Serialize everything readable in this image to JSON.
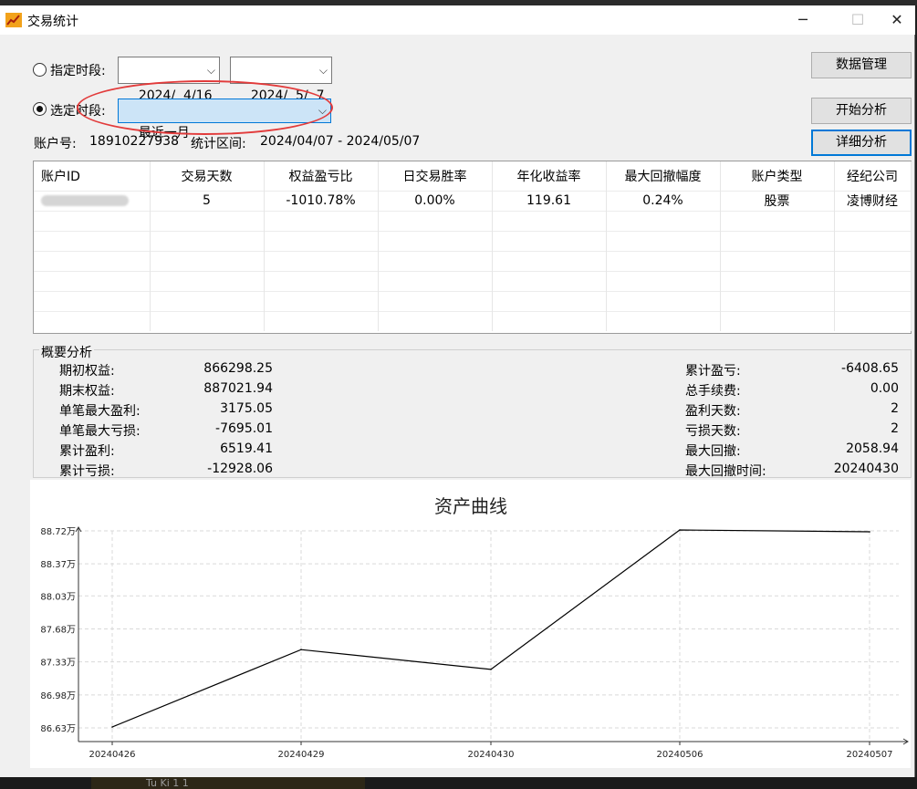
{
  "window": {
    "title": "交易统计",
    "min_glyph": "─",
    "max_glyph": "☐",
    "close_glyph": "✕"
  },
  "filters": {
    "specified_label": "指定时段:",
    "start_date": "2024/  4/16",
    "end_date": "2024/  5/  7",
    "preset_label": "选定时段:",
    "preset_value": "最近一月",
    "dropdown_arrow": "⌵"
  },
  "info": {
    "account_label": "账户号:",
    "account_no": "18910227938",
    "range_label": "统计区间:",
    "range": "2024/04/07 - 2024/05/07"
  },
  "buttons": {
    "data_manage": "数据管理",
    "start_analysis": "开始分析",
    "detail_analysis": "详细分析"
  },
  "table": {
    "columns": [
      "账户ID",
      "交易天数",
      "权益盈亏比",
      "日交易胜率",
      "年化收益率",
      "最大回撤幅度",
      "账户类型",
      "经纪公司"
    ],
    "rows": [
      [
        "",
        "5",
        "-1010.78%",
        "0.00%",
        "119.61",
        "0.24%",
        "股票",
        "凌博财经"
      ]
    ]
  },
  "summary": {
    "title": "概要分析",
    "left": [
      {
        "label": "期初权益:",
        "value": "866298.25"
      },
      {
        "label": "期末权益:",
        "value": "887021.94"
      },
      {
        "label": "单笔最大盈利:",
        "value": "3175.05"
      },
      {
        "label": "单笔最大亏损:",
        "value": "-7695.01"
      },
      {
        "label": "累计盈利:",
        "value": "6519.41"
      },
      {
        "label": "累计亏损:",
        "value": "-12928.06"
      }
    ],
    "right": [
      {
        "label": "累计盈亏:",
        "value": "-6408.65"
      },
      {
        "label": "总手续费:",
        "value": "0.00"
      },
      {
        "label": "盈利天数:",
        "value": "2"
      },
      {
        "label": "亏损天数:",
        "value": "2"
      },
      {
        "label": "最大回撤:",
        "value": "2058.94"
      },
      {
        "label": "最大回撤时间:",
        "value": "20240430"
      }
    ]
  },
  "chart_data": {
    "type": "line",
    "title": "资产曲线",
    "x": [
      "20240426",
      "20240429",
      "20240430",
      "20240506",
      "20240507"
    ],
    "series": [
      {
        "values": [
          86.64,
          87.46,
          87.25,
          88.73,
          88.71
        ]
      }
    ],
    "yticks": [
      "88.72万",
      "88.37万",
      "88.03万",
      "87.68万",
      "87.33万",
      "86.98万",
      "86.63万"
    ],
    "ytick_values": [
      88.72,
      88.37,
      88.03,
      87.68,
      87.33,
      86.98,
      86.63
    ],
    "grid": true,
    "line_color": "#000000",
    "grid_color": "#d9d9d9"
  },
  "footer": {
    "partial_text": "Tu Ki 1 1"
  }
}
